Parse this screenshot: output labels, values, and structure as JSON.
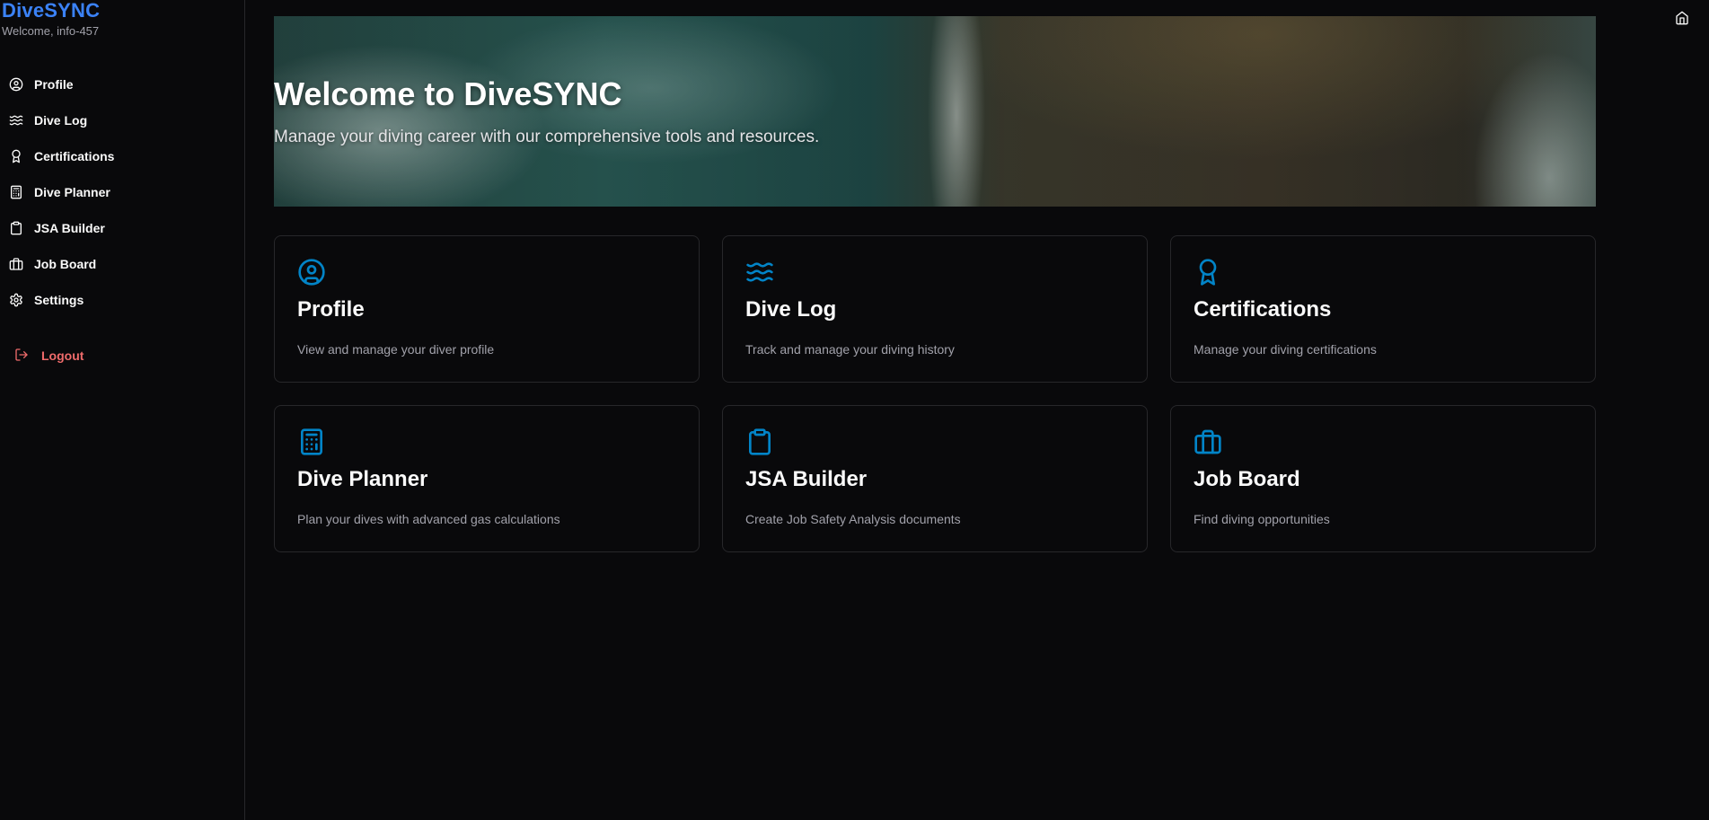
{
  "brand": {
    "title": "DiveSYNC",
    "welcome": "Welcome, info-457"
  },
  "sidebar": {
    "items": [
      {
        "label": "Profile",
        "icon": "user-circle-icon"
      },
      {
        "label": "Dive Log",
        "icon": "waves-icon"
      },
      {
        "label": "Certifications",
        "icon": "award-icon"
      },
      {
        "label": "Dive Planner",
        "icon": "calculator-icon"
      },
      {
        "label": "JSA Builder",
        "icon": "clipboard-icon"
      },
      {
        "label": "Job Board",
        "icon": "briefcase-icon"
      },
      {
        "label": "Settings",
        "icon": "gear-icon"
      }
    ],
    "logout": "Logout"
  },
  "hero": {
    "title": "Welcome to DiveSYNC",
    "subtitle": "Manage your diving career with our comprehensive tools and resources."
  },
  "cards": [
    {
      "title": "Profile",
      "desc": "View and manage your diver profile",
      "icon": "user-circle-icon"
    },
    {
      "title": "Dive Log",
      "desc": "Track and manage your diving history",
      "icon": "waves-icon"
    },
    {
      "title": "Certifications",
      "desc": "Manage your diving certifications",
      "icon": "award-icon"
    },
    {
      "title": "Dive Planner",
      "desc": "Plan your dives with advanced gas calculations",
      "icon": "calculator-icon"
    },
    {
      "title": "JSA Builder",
      "desc": "Create Job Safety Analysis documents",
      "icon": "clipboard-icon"
    },
    {
      "title": "Job Board",
      "desc": "Find diving opportunities",
      "icon": "briefcase-icon"
    }
  ],
  "colors": {
    "brand": "#3b82f6",
    "accent_icon": "#0284c7",
    "logout": "#ef6b6b",
    "background": "#09090b",
    "border": "#27272a"
  }
}
